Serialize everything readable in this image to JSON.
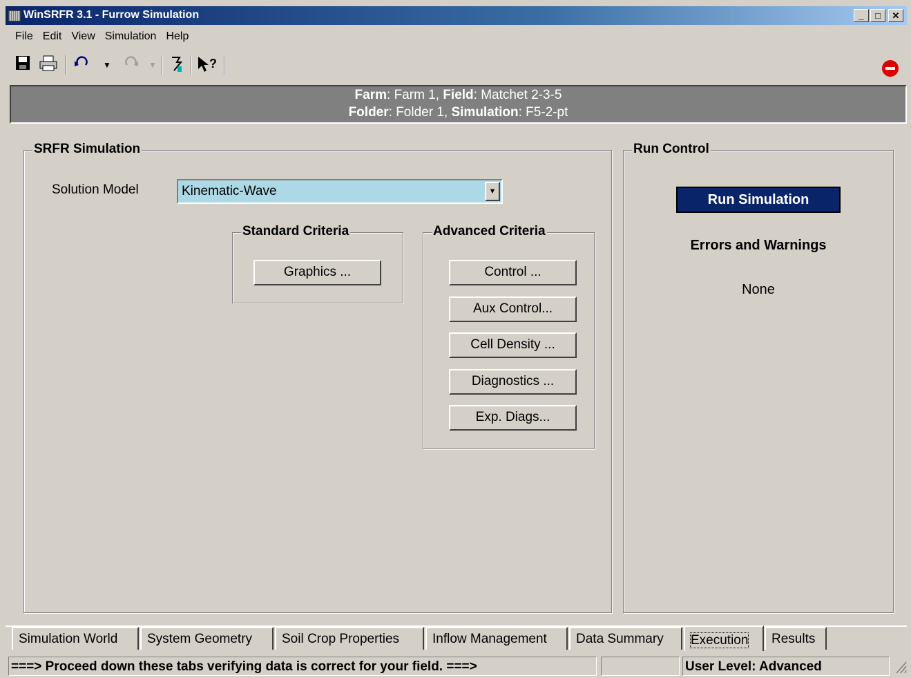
{
  "window": {
    "title": "WinSRFR 3.1 - Furrow Simulation"
  },
  "menu": [
    "File",
    "Edit",
    "View",
    "Simulation",
    "Help"
  ],
  "toolbar": {
    "icons": [
      "save-icon",
      "print-icon",
      "undo-icon",
      "redo-icon",
      "wizard-icon",
      "help-pointer-icon",
      "stop-icon"
    ]
  },
  "header": {
    "farm_label": "Farm",
    "farm_value": "Farm 1,",
    "field_label": "Field",
    "field_value": "Matchet 2-3-5",
    "folder_label": "Folder",
    "folder_value": "Folder 1,",
    "simulation_label": "Simulation",
    "simulation_value": "F5-2-pt"
  },
  "srfr": {
    "title": "SRFR Simulation",
    "solution_model_label": "Solution Model",
    "solution_model_value": "Kinematic-Wave",
    "standard_title": "Standard Criteria",
    "graphics_btn": "Graphics ...",
    "advanced_title": "Advanced Criteria",
    "control_btn": "Control ...",
    "aux_control_btn": "Aux Control...",
    "cell_density_btn": "Cell Density ...",
    "diagnostics_btn": "Diagnostics ...",
    "exp_diags_btn": "Exp. Diags..."
  },
  "run": {
    "title": "Run Control",
    "run_btn": "Run Simulation",
    "errors_title": "Errors and Warnings",
    "errors_value": "None"
  },
  "tabs": [
    "Simulation World",
    "System Geometry",
    "Soil Crop Properties",
    "Inflow Management",
    "Data Summary",
    "Execution",
    "Results"
  ],
  "status": {
    "message": "===> Proceed down these tabs verifying data is correct for your field. ===>",
    "user_level": "User Level:  Advanced"
  },
  "colors": {
    "title_bar": "#0a246a",
    "combo_bg": "#add8e6",
    "run_btn_bg": "#0a246a",
    "stop_icon": "#e00000"
  }
}
